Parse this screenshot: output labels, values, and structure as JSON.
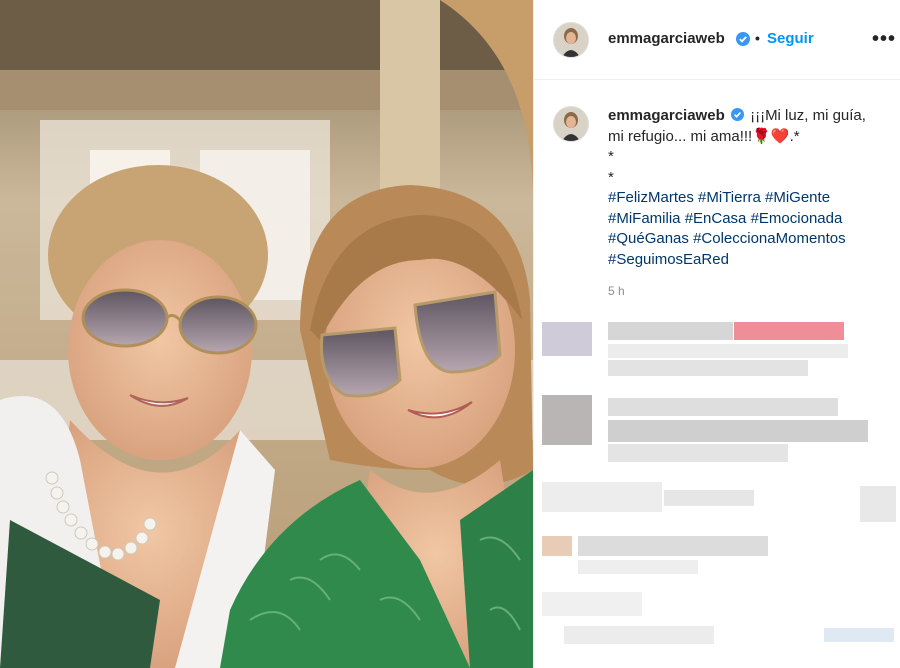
{
  "post": {
    "photo_alt": "",
    "colors": {
      "accent": "#0095f6",
      "hashtag": "#00376b",
      "text": "#262626",
      "muted": "#8e8e8e"
    }
  },
  "header": {
    "username": "emmagarciaweb",
    "separator": "•",
    "follow_label": "Seguir",
    "more_label": "•••",
    "verified_icon": "verified-badge-icon",
    "more_icon": "more-options-icon"
  },
  "caption": {
    "username": "emmagarciaweb",
    "text_line1": "¡¡¡Mi luz, mi guía,",
    "text_line2": "mi refugio... mi ama!!!",
    "emoji": "🌹❤️",
    "text_end": ".*",
    "star1": "*",
    "star2": "*",
    "hashtags": [
      "#FelizMartes",
      "#MiTierra",
      "#MiGente",
      "#MiFamilia",
      "#EnCasa",
      "#Emocionada",
      "#QuéGanas",
      "#ColeccionaMomentos",
      "#SeguimosEaRed"
    ],
    "time": "5 h"
  }
}
